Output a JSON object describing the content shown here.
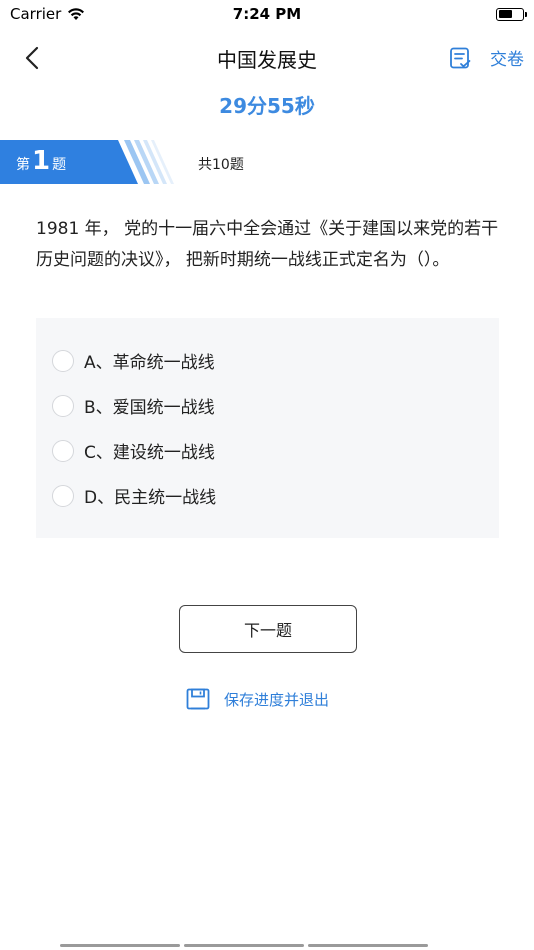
{
  "status_bar": {
    "carrier": "Carrier",
    "time": "7:24 PM",
    "wifi_icon": "wifi-icon",
    "battery_icon": "battery-icon"
  },
  "nav": {
    "title": "中国发展史",
    "back_icon": "chevron-left-icon",
    "answer_sheet_icon": "answer-sheet-icon",
    "submit_label": "交卷"
  },
  "timer": "29分55秒",
  "question": {
    "prefix": "第",
    "number": "1",
    "suffix": "题",
    "total": "共10题",
    "text": "1981 年， 党的十一届六中全会通过《关于建国以来党的若干历史问题的决议》， 把新时期统一战线正式定名为（）。",
    "options": [
      {
        "label": "A、革命统一战线"
      },
      {
        "label": "B、爱国统一战线"
      },
      {
        "label": "C、建设统一战线"
      },
      {
        "label": "D、民主统一战线"
      }
    ]
  },
  "actions": {
    "next_label": "下一题",
    "save_exit_label": "保存进度并退出",
    "save_icon": "save-icon"
  },
  "colors": {
    "accent": "#2f7fd9",
    "timer": "#3d8ae0",
    "banner": "#2f80e0",
    "option_bg": "#f6f7f9"
  }
}
